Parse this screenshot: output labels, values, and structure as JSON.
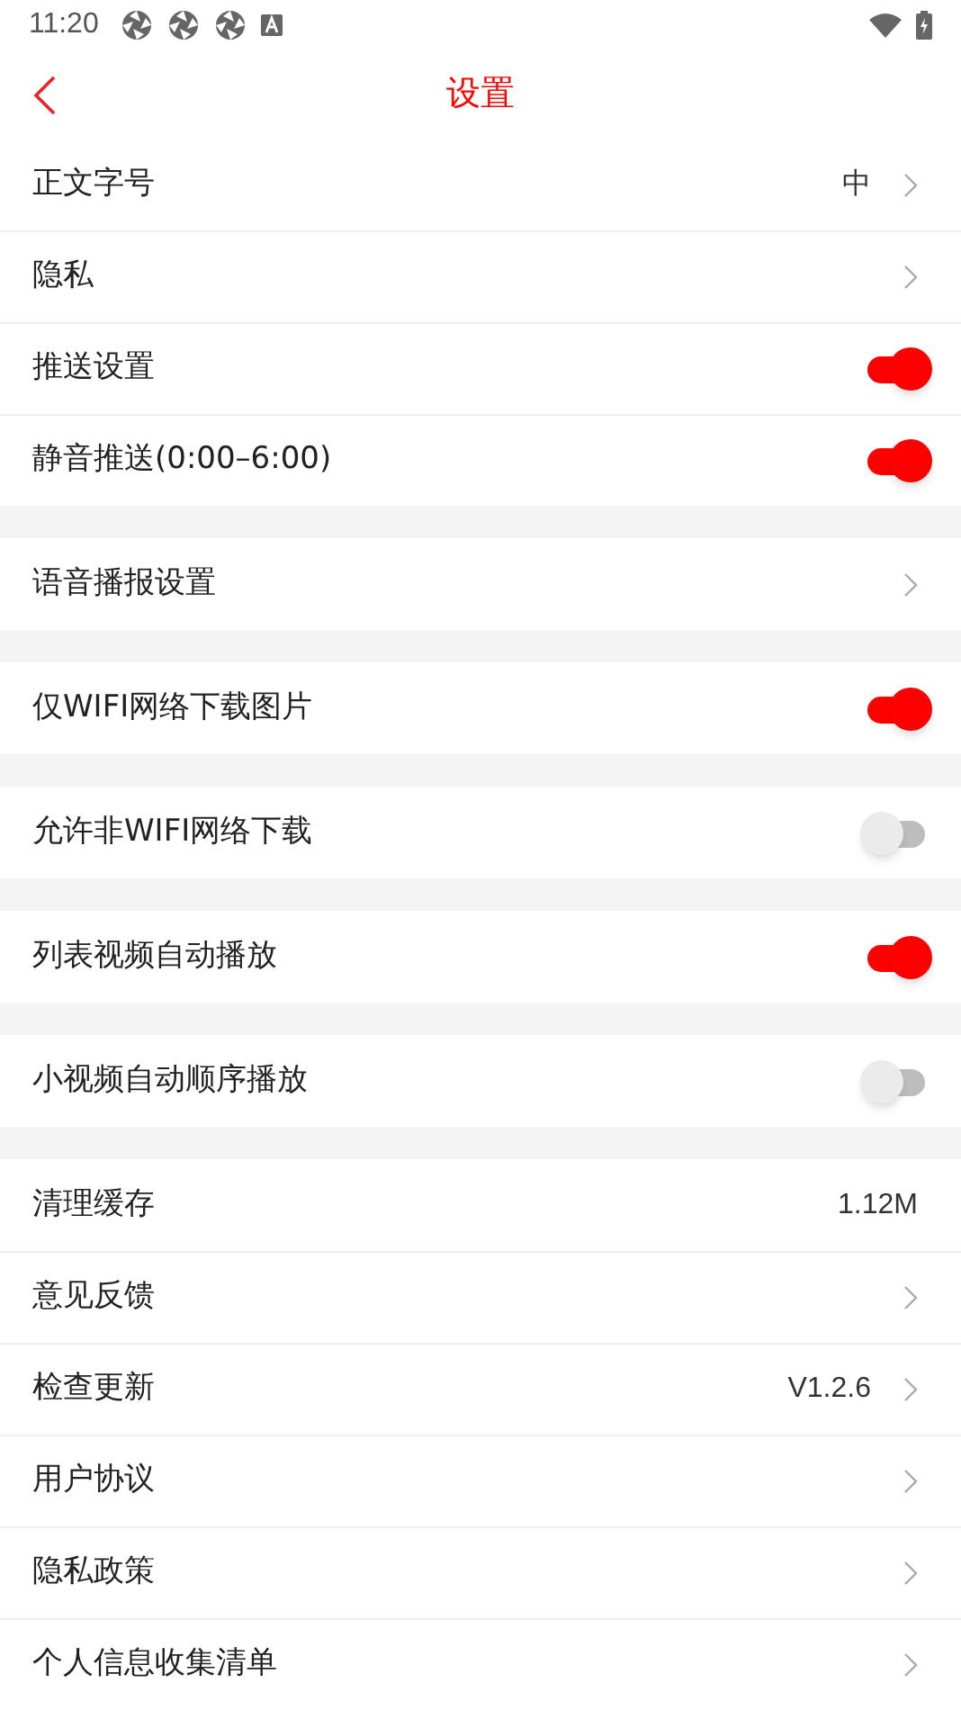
{
  "status_bar": {
    "time": "11:20"
  },
  "header": {
    "title": "设置"
  },
  "sections": [
    {
      "rows": [
        {
          "kind": "link",
          "label": "正文字号",
          "value": "中"
        },
        {
          "kind": "link",
          "label": "隐私"
        },
        {
          "kind": "toggle",
          "label": "推送设置",
          "on": true
        },
        {
          "kind": "toggle",
          "label": "静音推送(0:00–6:00)",
          "on": true
        }
      ]
    },
    {
      "rows": [
        {
          "kind": "link",
          "label": "语音播报设置"
        }
      ]
    },
    {
      "rows": [
        {
          "kind": "toggle",
          "label": "仅WIFI网络下载图片",
          "on": true
        }
      ]
    },
    {
      "rows": [
        {
          "kind": "toggle",
          "label": "允许非WIFI网络下载",
          "on": false
        }
      ]
    },
    {
      "rows": [
        {
          "kind": "toggle",
          "label": "列表视频自动播放",
          "on": true
        }
      ]
    },
    {
      "rows": [
        {
          "kind": "toggle",
          "label": "小视频自动顺序播放",
          "on": false
        }
      ]
    },
    {
      "rows": [
        {
          "kind": "value",
          "label": "清理缓存",
          "value": "1.12M"
        },
        {
          "kind": "link",
          "label": "意见反馈"
        },
        {
          "kind": "link",
          "label": "检查更新",
          "value": "V1.2.6"
        },
        {
          "kind": "link",
          "label": "用户协议"
        },
        {
          "kind": "link",
          "label": "隐私政策"
        },
        {
          "kind": "link",
          "label": "个人信息收集清单"
        }
      ]
    }
  ]
}
